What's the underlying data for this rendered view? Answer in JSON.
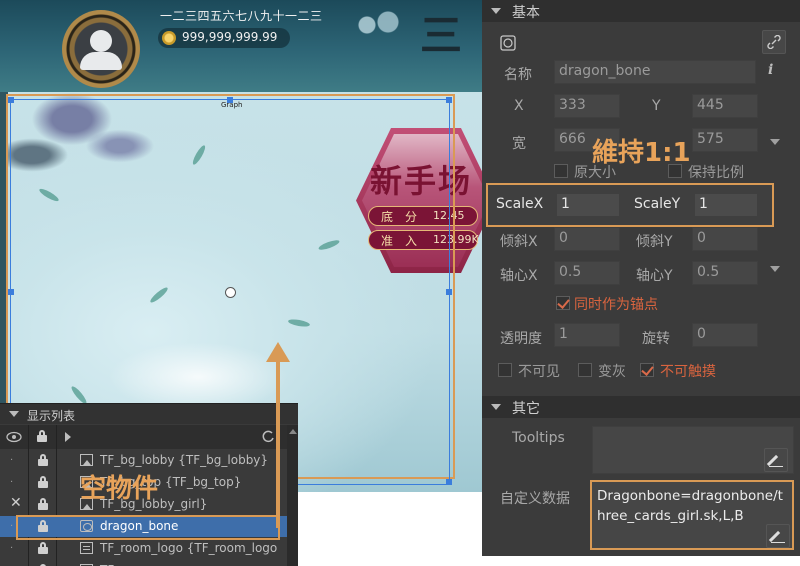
{
  "scene": {
    "player_name": "一二三四五六七八九十一二三",
    "coins": "999,999,999.99",
    "title_glyph": "三",
    "graph_label": "Graph",
    "room": {
      "title": "新手场",
      "base_label": "底分",
      "base_value": "12.45",
      "entry_label": "准入",
      "entry_value": "123.99K"
    }
  },
  "display_list": {
    "title": "显示列表",
    "rows": [
      {
        "label": "TF_bg_lobby {TF_bg_lobby}",
        "icon": "image-icon",
        "selected": false
      },
      {
        "label": "TF_bg_top {TF_bg_top}",
        "icon": "image-icon",
        "selected": false
      },
      {
        "label": "TF_bg_lobby_girl}",
        "icon": "image-icon",
        "selected": false
      },
      {
        "label": "dragon_bone",
        "icon": "object-icon",
        "selected": true
      },
      {
        "label": "TF_room_logo {TF_room_logo",
        "icon": "text-icon",
        "selected": false
      },
      {
        "label": "TF_...",
        "icon": "image-icon",
        "selected": false
      }
    ]
  },
  "annotations": {
    "empty_object": "空物件",
    "keep_ratio": "維持1:1"
  },
  "props": {
    "section_basic": "基本",
    "section_other": "其它",
    "name_label": "名称",
    "name_value": "dragon_bone",
    "info_icon": "i",
    "x_label": "X",
    "x_value": "333",
    "y_label": "Y",
    "y_value": "445",
    "w_label": "宽",
    "w_value": "666",
    "h_value": "575",
    "orig_size_label": "原大小",
    "keep_ratio_label": "保持比例",
    "scalex_label": "ScaleX",
    "scalex_value": "1",
    "scaley_label": "ScaleY",
    "scaley_value": "1",
    "skewx_label": "倾斜X",
    "skewx_value": "0",
    "skewy_label": "倾斜Y",
    "skewy_value": "0",
    "pivotx_label": "轴心X",
    "pivotx_value": "0.5",
    "pivoty_label": "轴心Y",
    "pivoty_value": "0.5",
    "anchor_label": "同时作为锚点",
    "alpha_label": "透明度",
    "alpha_value": "1",
    "rotation_label": "旋转",
    "rotation_value": "0",
    "invisible_label": "不可见",
    "gray_label": "变灰",
    "untouchable_label": "不可触摸",
    "tooltips_label": "Tooltips",
    "custom_data_label": "自定义数据",
    "custom_data_value": "Dragonbone=dragonbone/three_cards_girl.sk,L,B"
  },
  "colors": {
    "annotation": "#d99a55",
    "selection": "#3b7ddc",
    "checked_red": "#d9643f"
  }
}
